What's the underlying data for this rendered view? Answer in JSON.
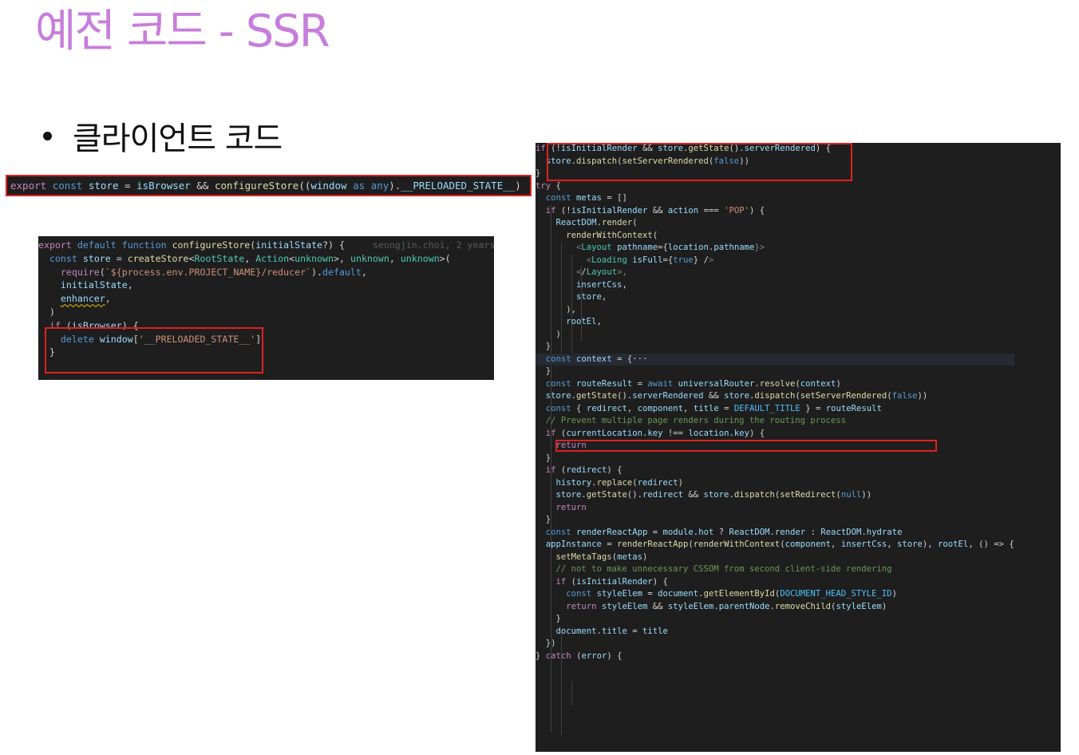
{
  "slide": {
    "title": "예전 코드 - SSR",
    "title_color": "#c77ddb",
    "bullet": "클라이언트 코드"
  },
  "export_line": {
    "code": "export const store = isBrowser && configureStore((window as any).__PRELOADED_STATE__)"
  },
  "configure_code": {
    "blame": "seongjin.choi, 2 years",
    "lines": [
      "export default function configureStore(initialState?) {",
      "  const store = createStore<RootState, Action<unknown>, unknown, unknown>(",
      "    require(`${process.env.PROJECT_NAME}/reducer`).default,",
      "    initialState,",
      "    enhancer,",
      "  )",
      "",
      "  if (isBrowser) {",
      "    delete window['__PRELOADED_STATE__']",
      "  }"
    ]
  },
  "render_code": {
    "lines": [
      "if (!isInitialRender && store.getState().serverRendered) {",
      "  store.dispatch(setServerRendered(false))",
      "}",
      "",
      "try {",
      "  const metas = []",
      "",
      "  if (!isInitialRender && action === 'POP') {",
      "    ReactDOM.render(",
      "      renderWithContext(",
      "        <Layout pathname={location.pathname}>",
      "          <Loading isFull={true} />",
      "        </Layout>,",
      "        insertCss,",
      "        store,",
      "      ),",
      "      rootEl,",
      "    )",
      "  }",
      "",
      "  const context = {···",
      "  }",
      "",
      "  const routeResult = await universalRouter.resolve(context)",
      "  store.getState().serverRendered && store.dispatch(setServerRendered(false))",
      "  const { redirect, component, title = DEFAULT_TITLE } = routeResult",
      "  // Prevent multiple page renders during the routing process",
      "  if (currentLocation.key !== location.key) {",
      "    return",
      "  }",
      "",
      "  if (redirect) {",
      "    history.replace(redirect)",
      "    store.getState().redirect && store.dispatch(setRedirect(null))",
      "    return",
      "  }",
      "",
      "  const renderReactApp = module.hot ? ReactDOM.render : ReactDOM.hydrate",
      "  appInstance = renderReactApp(renderWithContext(component, insertCss, store), rootEl, () => {",
      "    setMetaTags(metas)",
      "",
      "    // not to make unnecessary CSSOM from second client-side rendering",
      "    if (isInitialRender) {",
      "      const styleElem = document.getElementById(DOCUMENT_HEAD_STYLE_ID)",
      "      return styleElem && styleElem.parentNode.removeChild(styleElem)",
      "    }",
      "    document.title = title",
      "  })",
      "} catch (error) {"
    ]
  }
}
